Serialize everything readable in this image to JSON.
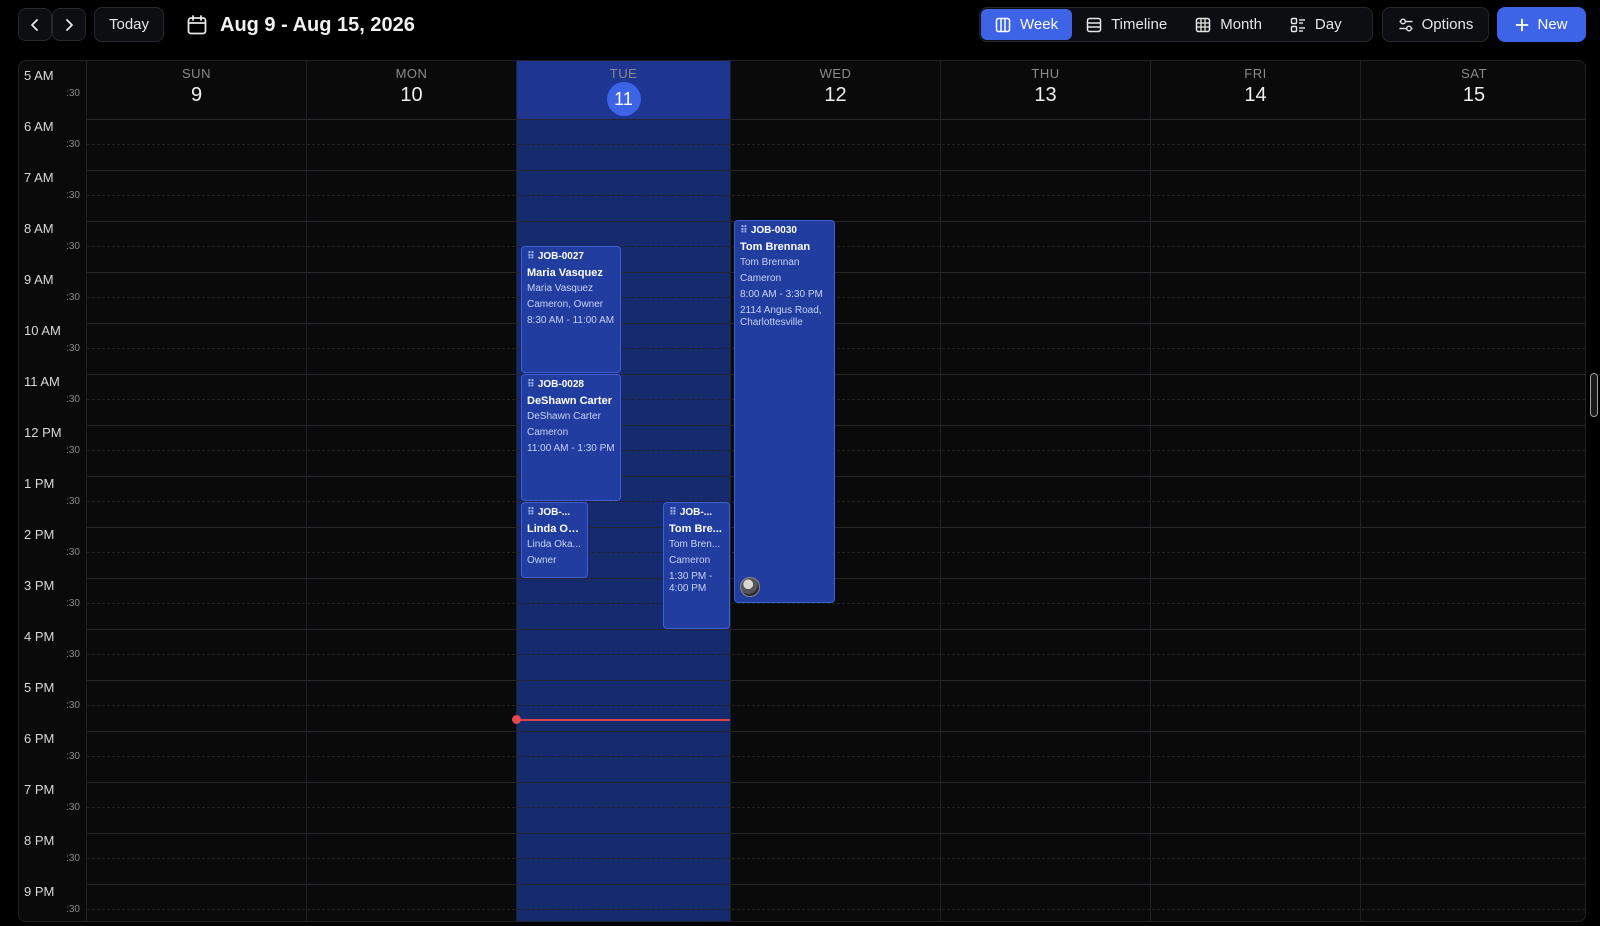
{
  "toolbar": {
    "today_label": "Today",
    "date_range": "Aug 9 - Aug 15, 2026",
    "views": [
      {
        "label": "Week",
        "icon": "columns-icon",
        "active": true
      },
      {
        "label": "Timeline",
        "icon": "rows-icon",
        "active": false
      },
      {
        "label": "Month",
        "icon": "grid-icon",
        "active": false
      },
      {
        "label": "Day",
        "icon": "list-icon",
        "active": false
      }
    ],
    "options_label": "Options",
    "new_label": "New"
  },
  "colors": {
    "accent": "#3d63e6",
    "today_column": "#162a6e",
    "event_fill": "#223da0",
    "now_indicator": "#e5484d"
  },
  "days": [
    {
      "name": "SUN",
      "num": "9"
    },
    {
      "name": "MON",
      "num": "10"
    },
    {
      "name": "TUE",
      "num": "11",
      "today": true
    },
    {
      "name": "WED",
      "num": "12"
    },
    {
      "name": "THU",
      "num": "13"
    },
    {
      "name": "FRI",
      "num": "14"
    },
    {
      "name": "SAT",
      "num": "15"
    }
  ],
  "hours": [
    "5 AM",
    "6 AM",
    "7 AM",
    "8 AM",
    "9 AM",
    "10 AM",
    "11 AM",
    "12 PM",
    "1 PM",
    "2 PM",
    "3 PM",
    "4 PM",
    "5 PM",
    "6 PM",
    "7 PM",
    "8 PM",
    "9 PM"
  ],
  "half_label": ":30",
  "events": [
    {
      "code": "JOB-0027",
      "title": "Maria Vasquez",
      "lines": [
        "Maria Vasquez",
        "Cameron, Owner",
        "8:30 AM - 11:00 AM"
      ]
    },
    {
      "code": "JOB-0028",
      "title": "DeShawn Carter",
      "lines": [
        "DeShawn Carter",
        "Cameron",
        "11:00 AM - 1:30 PM"
      ]
    },
    {
      "code": "JOB-...",
      "title": "Linda Ok...",
      "lines": [
        "Linda Oka...",
        "Owner"
      ]
    },
    {
      "code": "JOB-...",
      "title": "Tom Bre...",
      "lines": [
        "Tom Bren...",
        "Cameron",
        "1:30 PM - 4:00 PM"
      ]
    },
    {
      "code": "JOB-0030",
      "title": "Tom Brennan",
      "lines": [
        "Tom Brennan",
        "Cameron",
        "8:00 AM - 3:30 PM",
        "2114 Angus Road, Charlottesville"
      ],
      "avatar": true
    }
  ]
}
